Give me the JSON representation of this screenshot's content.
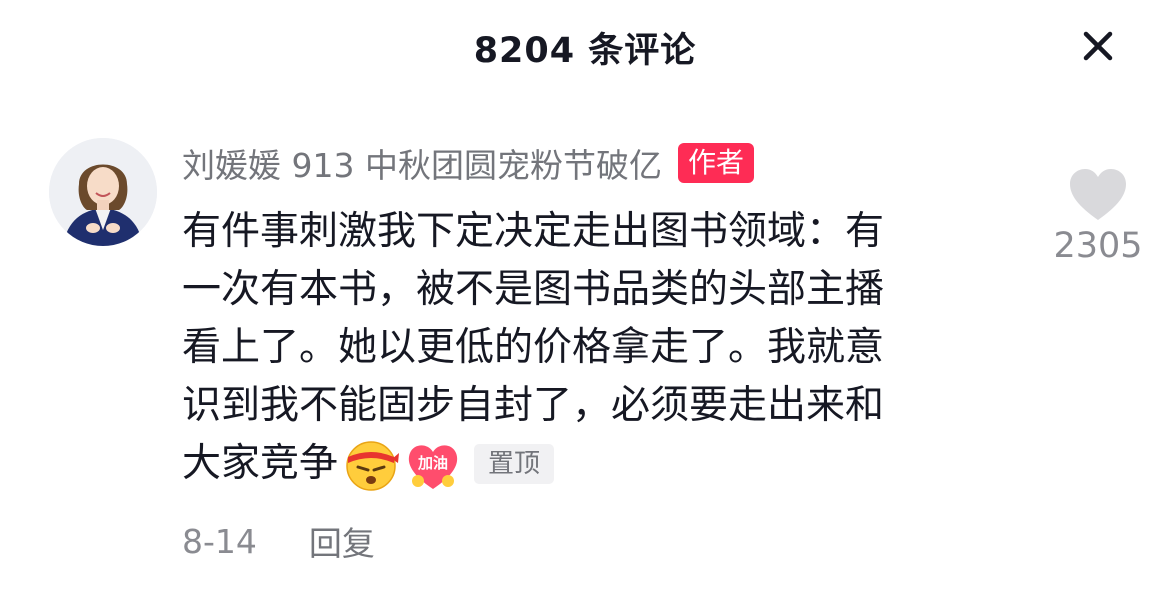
{
  "header": {
    "title": "8204 条评论"
  },
  "comment": {
    "author": "刘媛媛 913 中秋团圆宠粉节破亿",
    "author_badge": "作者",
    "lines": [
      "有件事刺激我下定决定走出图书领域：有",
      "一次有本书，被不是图书品类的头部主播",
      "看上了。她以更低的价格拿走了。我就意",
      "识到我不能固步自封了，必须要走出来和",
      "大家竞争"
    ],
    "emojis": [
      "headband-determined-emoji",
      "jiayou-heart-emoji"
    ],
    "emoji_jiayou_text": "加油",
    "pinned_label": "置顶",
    "date": "8-14",
    "reply_label": "回复",
    "like_count": "2305"
  },
  "colors": {
    "accent": "#fe2c55",
    "secondary_text": "#73757b",
    "primary_text": "#161823",
    "like_icon": "#d9d9dc"
  }
}
